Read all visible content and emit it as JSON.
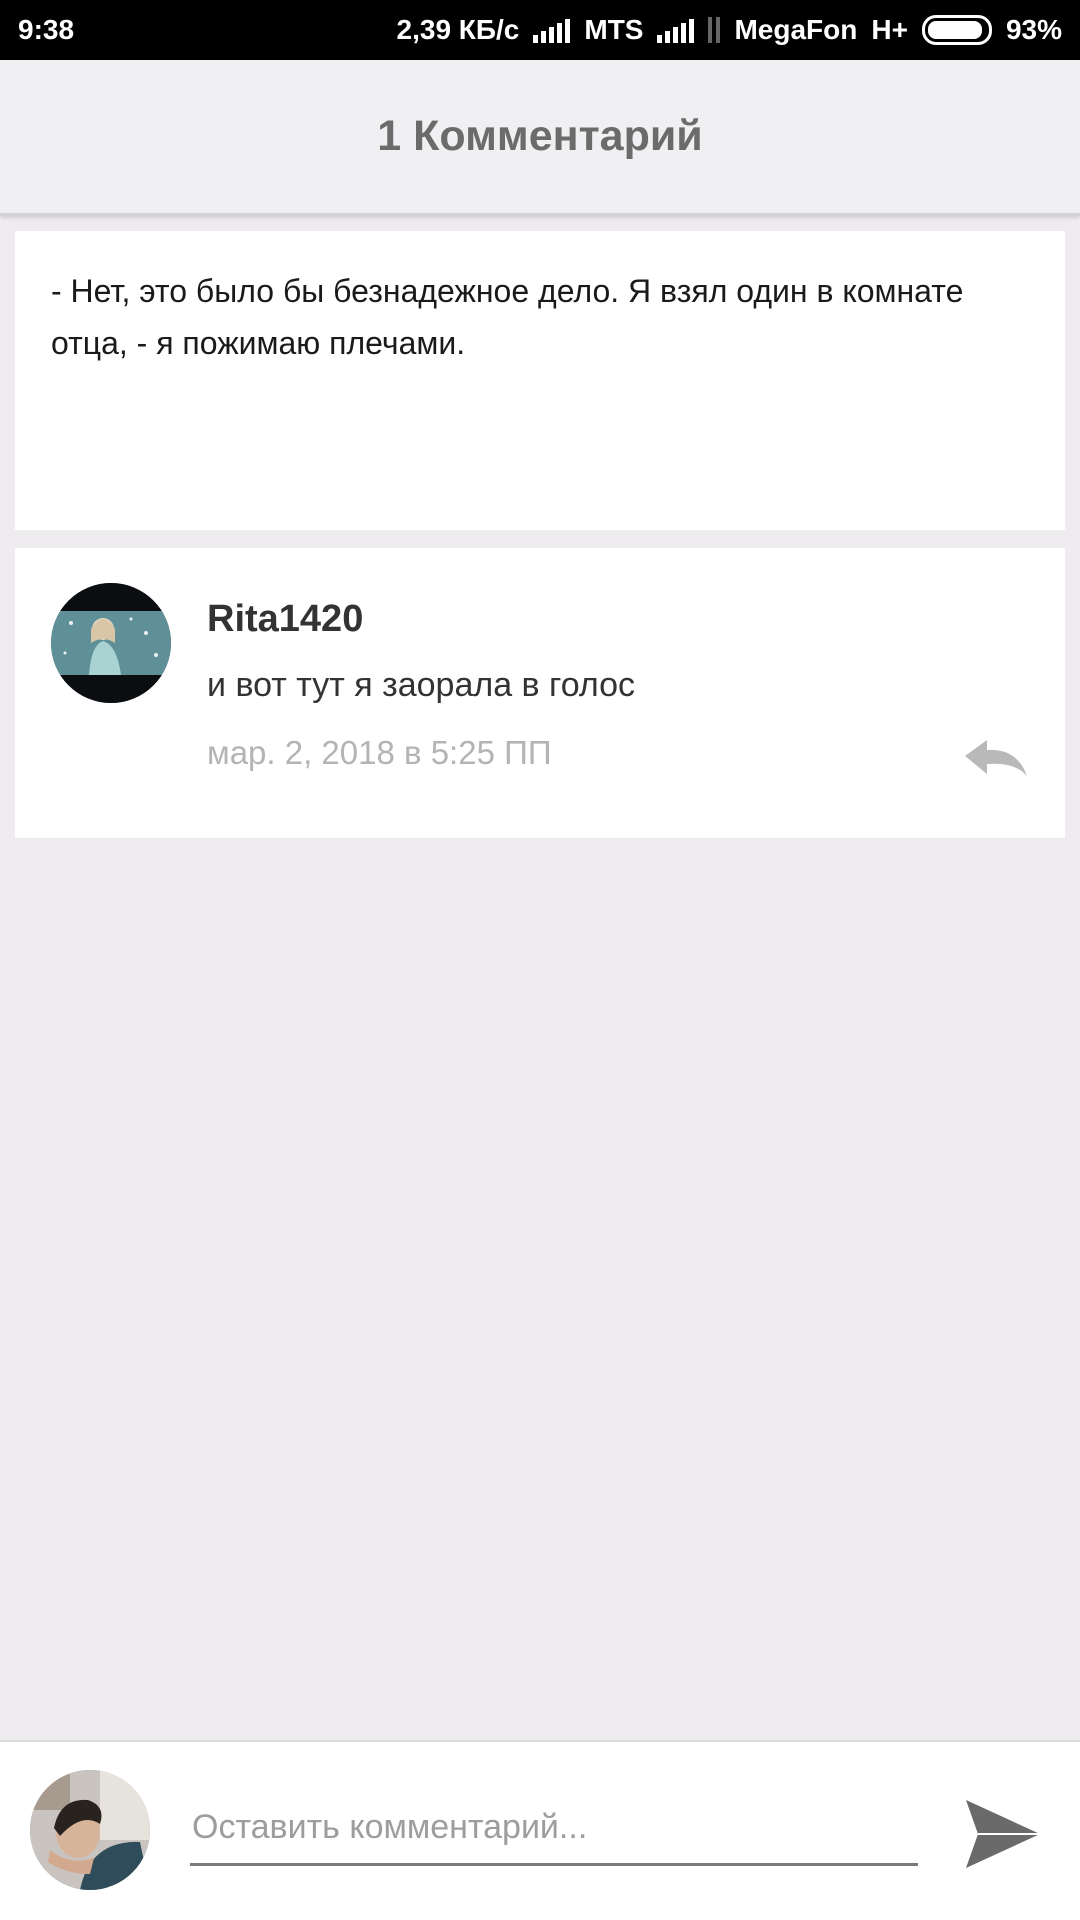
{
  "status_bar": {
    "time": "9:38",
    "speed": "2,39 КБ/с",
    "carrier1": "MTS",
    "carrier2": "MegaFon",
    "network_type": "H+",
    "battery": "93%",
    "battery_level": 0.93
  },
  "header": {
    "title": "1 Комментарий"
  },
  "quote": {
    "text": "- Нет, это было бы безнадежное дело. Я взял один в комнате отца, - я пожимаю плечами."
  },
  "comments": [
    {
      "author": "Rita1420",
      "text": "и вот тут я заорала в голос",
      "date": "мар. 2, 2018 в 5:25 ПП",
      "reply_icon": "reply-icon"
    }
  ],
  "composer": {
    "placeholder": "Оставить комментарий...",
    "value": "",
    "send_icon": "send-icon"
  },
  "colors": {
    "background": "#eeecef",
    "header_bg": "#f0eff1",
    "title_text": "#6b6b6b",
    "muted_text": "#b4b4b4"
  }
}
